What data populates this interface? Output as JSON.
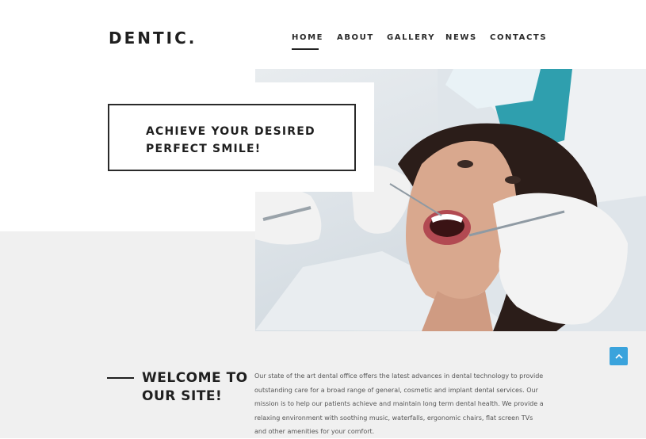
{
  "header": {
    "logo": "DENTIC.",
    "nav": [
      {
        "label": "HOME",
        "active": true
      },
      {
        "label": "ABOUT",
        "active": false
      },
      {
        "label": "GALLERY",
        "active": false
      },
      {
        "label": "NEWS",
        "active": false
      },
      {
        "label": "CONTACTS",
        "active": false
      }
    ]
  },
  "hero": {
    "promo_line1": "ACHIEVE YOUR DESIRED",
    "promo_line2": "PERFECT SMILE!",
    "image_icon": "dental-exam-photo"
  },
  "welcome": {
    "title_line1": "WELCOME TO",
    "title_line2": "OUR SITE!",
    "body": "Our state of the art dental office offers the latest advances in dental technology to provide outstanding care for a broad range of general, cosmetic and implant dental services. Our mission is to help our patients achieve and maintain long term dental health. We provide a relaxing environment with soothing music, waterfalls, ergonomic chairs, flat screen TVs and other amenities for your comfort."
  },
  "scroll_top": {
    "icon": "chevron-up-icon"
  },
  "colors": {
    "accent": "#3aa3dc",
    "text": "#1f1f1f",
    "band": "#f0f0f0"
  }
}
